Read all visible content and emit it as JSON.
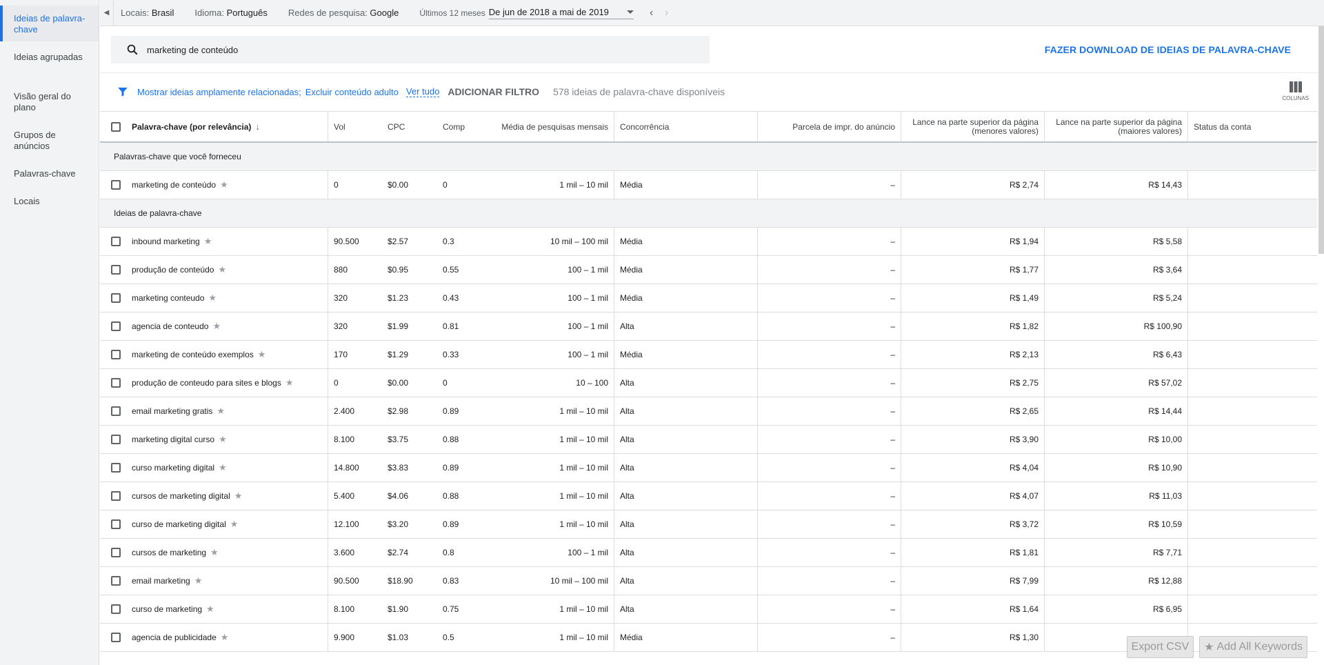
{
  "sidebar": {
    "items": [
      {
        "label": "Ideias de palavra-chave",
        "active": true
      },
      {
        "label": "Ideias agrupadas",
        "active": false
      },
      {
        "label": "Visão geral do plano",
        "active": false
      },
      {
        "label": "Grupos de anúncios",
        "active": false
      },
      {
        "label": "Palavras-chave",
        "active": false
      },
      {
        "label": "Locais",
        "active": false
      }
    ]
  },
  "topbar": {
    "locations_label": "Locais:",
    "locations_value": "Brasil",
    "language_label": "Idioma:",
    "language_value": "Português",
    "network_label": "Redes de pesquisa:",
    "network_value": "Google",
    "period_label": "Últimos 12 meses",
    "period_value": "De jun de 2018 a mai de 2019"
  },
  "search": {
    "value": "marketing de conteúdo"
  },
  "download_label": "FAZER DOWNLOAD DE IDEIAS DE PALAVRA-CHAVE",
  "filters": {
    "link1": "Mostrar ideias amplamente relacionadas;",
    "link2": "Excluir conteúdo adulto",
    "see_all": "Ver tudo",
    "add_filter": "ADICIONAR FILTRO",
    "count": "578 ideias de palavra-chave disponíveis",
    "columns_label": "COLUNAS"
  },
  "table": {
    "headers": {
      "keyword": "Palavra-chave (por relevância)",
      "vol": "Vol",
      "cpc": "CPC",
      "comp": "Comp",
      "avg": "Média de pesquisas mensais",
      "competition": "Concorrência",
      "impr": "Parcela de impr. do anúncio",
      "bid_low": "Lance na parte superior da página (menores valores)",
      "bid_high": "Lance na parte superior da página (maiores valores)",
      "status": "Status da conta"
    },
    "group1": "Palavras-chave que você forneceu",
    "provided": [
      {
        "kw": "marketing de conteúdo",
        "vol": "0",
        "cpc": "$0.00",
        "comp": "0",
        "avg": "1 mil – 10 mil",
        "conc": "Média",
        "impr": "–",
        "low": "R$ 2,74",
        "high": "R$ 14,43"
      }
    ],
    "group2": "Ideias de palavra-chave",
    "ideas": [
      {
        "kw": "inbound marketing",
        "vol": "90.500",
        "cpc": "$2.57",
        "comp": "0.3",
        "avg": "10 mil – 100 mil",
        "conc": "Média",
        "impr": "–",
        "low": "R$ 1,94",
        "high": "R$ 5,58"
      },
      {
        "kw": "produção de conteúdo",
        "vol": "880",
        "cpc": "$0.95",
        "comp": "0.55",
        "avg": "100 – 1 mil",
        "conc": "Média",
        "impr": "–",
        "low": "R$ 1,77",
        "high": "R$ 3,64"
      },
      {
        "kw": "marketing conteudo",
        "vol": "320",
        "cpc": "$1.23",
        "comp": "0.43",
        "avg": "100 – 1 mil",
        "conc": "Média",
        "impr": "–",
        "low": "R$ 1,49",
        "high": "R$ 5,24"
      },
      {
        "kw": "agencia de conteudo",
        "vol": "320",
        "cpc": "$1.99",
        "comp": "0.81",
        "avg": "100 – 1 mil",
        "conc": "Alta",
        "impr": "–",
        "low": "R$ 1,82",
        "high": "R$ 100,90"
      },
      {
        "kw": "marketing de conteúdo exemplos",
        "vol": "170",
        "cpc": "$1.29",
        "comp": "0.33",
        "avg": "100 – 1 mil",
        "conc": "Média",
        "impr": "–",
        "low": "R$ 2,13",
        "high": "R$ 6,43"
      },
      {
        "kw": "produção de conteudo para sites e blogs",
        "vol": "0",
        "cpc": "$0.00",
        "comp": "0",
        "avg": "10 – 100",
        "conc": "Alta",
        "impr": "–",
        "low": "R$ 2,75",
        "high": "R$ 57,02"
      },
      {
        "kw": "email marketing gratis",
        "vol": "2.400",
        "cpc": "$2.98",
        "comp": "0.89",
        "avg": "1 mil – 10 mil",
        "conc": "Alta",
        "impr": "–",
        "low": "R$ 2,65",
        "high": "R$ 14,44"
      },
      {
        "kw": "marketing digital curso",
        "vol": "8.100",
        "cpc": "$3.75",
        "comp": "0.88",
        "avg": "1 mil – 10 mil",
        "conc": "Alta",
        "impr": "–",
        "low": "R$ 3,90",
        "high": "R$ 10,00"
      },
      {
        "kw": "curso marketing digital",
        "vol": "14.800",
        "cpc": "$3.83",
        "comp": "0.89",
        "avg": "1 mil – 10 mil",
        "conc": "Alta",
        "impr": "–",
        "low": "R$ 4,04",
        "high": "R$ 10,90"
      },
      {
        "kw": "cursos de marketing digital",
        "vol": "5.400",
        "cpc": "$4.06",
        "comp": "0.88",
        "avg": "1 mil – 10 mil",
        "conc": "Alta",
        "impr": "–",
        "low": "R$ 4,07",
        "high": "R$ 11,03"
      },
      {
        "kw": "curso de marketing digital",
        "vol": "12.100",
        "cpc": "$3.20",
        "comp": "0.89",
        "avg": "1 mil – 10 mil",
        "conc": "Alta",
        "impr": "–",
        "low": "R$ 3,72",
        "high": "R$ 10,59"
      },
      {
        "kw": "cursos de marketing",
        "vol": "3.600",
        "cpc": "$2.74",
        "comp": "0.8",
        "avg": "100 – 1 mil",
        "conc": "Alta",
        "impr": "–",
        "low": "R$ 1,81",
        "high": "R$ 7,71"
      },
      {
        "kw": "email marketing",
        "vol": "90.500",
        "cpc": "$18.90",
        "comp": "0.83",
        "avg": "10 mil – 100 mil",
        "conc": "Alta",
        "impr": "–",
        "low": "R$ 7,99",
        "high": "R$ 12,88"
      },
      {
        "kw": "curso de marketing",
        "vol": "8.100",
        "cpc": "$1.90",
        "comp": "0.75",
        "avg": "1 mil – 10 mil",
        "conc": "Alta",
        "impr": "–",
        "low": "R$ 1,64",
        "high": "R$ 6,95"
      },
      {
        "kw": "agencia de publicidade",
        "vol": "9.900",
        "cpc": "$1.03",
        "comp": "0.5",
        "avg": "1 mil – 10 mil",
        "conc": "Média",
        "impr": "–",
        "low": "R$ 1,30",
        "high": ""
      }
    ]
  },
  "buttons": {
    "export_csv": "Export CSV",
    "add_all": "Add All Keywords"
  }
}
